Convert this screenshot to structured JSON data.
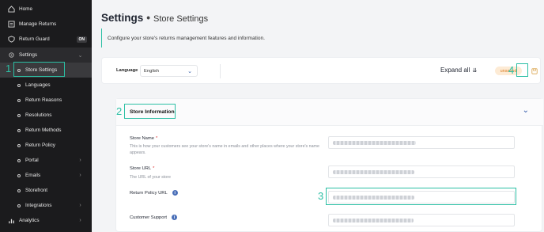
{
  "sidebar": {
    "items": [
      {
        "label": "Home",
        "icon": "home-icon"
      },
      {
        "label": "Manage Returns",
        "icon": "returns-icon"
      },
      {
        "label": "Return Guard",
        "icon": "shield-icon",
        "badge": "ON"
      },
      {
        "label": "Settings",
        "icon": "gear-icon"
      },
      {
        "label": "Store Settings"
      },
      {
        "label": "Languages"
      },
      {
        "label": "Return Reasons"
      },
      {
        "label": "Resolutions"
      },
      {
        "label": "Return Methods"
      },
      {
        "label": "Return Policy"
      },
      {
        "label": "Portal"
      },
      {
        "label": "Emails"
      },
      {
        "label": "Storefront"
      },
      {
        "label": "Integrations"
      },
      {
        "label": "Analytics",
        "icon": "chart-icon"
      }
    ]
  },
  "header": {
    "title": "Settings",
    "separator": "•",
    "breadcrumb": "Store Settings",
    "description": "Configure your store's returns management features and information."
  },
  "toolbar": {
    "language_label": "Language",
    "language_value": "English",
    "expand_all_label": "Expand all",
    "unsaved_label": "unsaved"
  },
  "section": {
    "title": "Store Information",
    "fields": [
      {
        "label": "Store Name",
        "required": "*",
        "help": "This is how your customers see your store's name in emails and other places where your store's name appears."
      },
      {
        "label": "Store URL",
        "required": "*",
        "help": "The URL of your store"
      },
      {
        "label": "Return Policy URL"
      },
      {
        "label": "Customer Support"
      }
    ]
  },
  "annotations": [
    "1",
    "2",
    "3",
    "4"
  ],
  "colors": {
    "accent": "#2bbfa4",
    "sidebar_bg": "#1b1b1d",
    "unsaved_text": "#d97a1f",
    "link_blue": "#2f57a8"
  }
}
